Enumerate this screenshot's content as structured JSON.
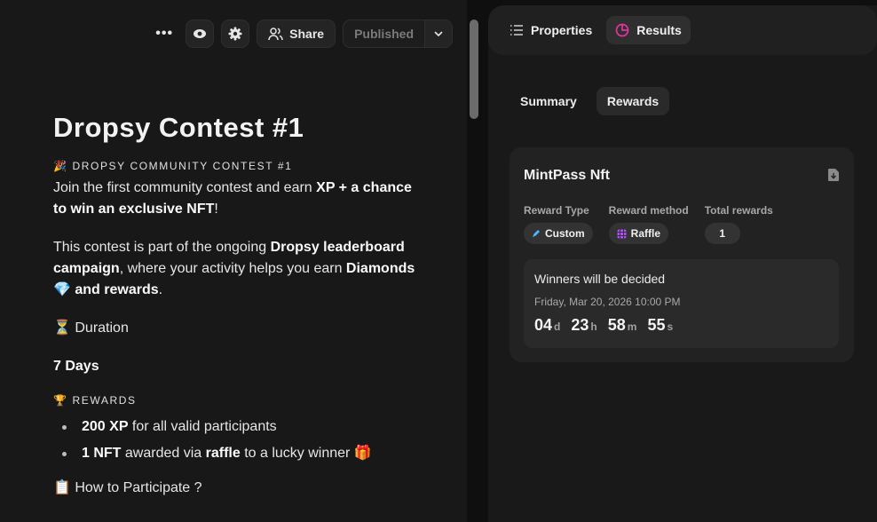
{
  "toolbar": {
    "more_icon": "more-horizontal-icon",
    "preview_icon": "eye-icon",
    "settings_icon": "gear-icon",
    "share_label": "Share",
    "status_label": "Published"
  },
  "article": {
    "title": "Dropsy Contest #1",
    "caption1_emoji": "🎉",
    "caption1": "DROPSY COMMUNITY CONTEST #1",
    "p1_a": "Join the first community contest and earn ",
    "p1_b": "XP + a chance to win an exclusive NFT",
    "p1_c": "!",
    "p2_a": "This contest is part of the ongoing ",
    "p2_b": "Dropsy leaderboard campaign",
    "p2_c": ", where your activity helps you earn ",
    "p2_d": "Diamonds 💎 and rewards",
    "p2_e": ".",
    "duration_label": "⏳ Duration",
    "duration_value": "7 Days",
    "caption2_emoji": "🏆",
    "caption2": "REWARDS",
    "reward1_b": "200 XP",
    "reward1_c": " for all valid participants",
    "reward2_b": "1 NFT",
    "reward2_c": " awarded via ",
    "reward2_d": "raffle",
    "reward2_e": " to a lucky winner 🎁",
    "how_label": "📋 How to Participate ?"
  },
  "panel": {
    "tabs": [
      {
        "label": "Properties",
        "icon": "list-icon"
      },
      {
        "label": "Results",
        "icon": "pie-chart-icon"
      }
    ],
    "subtabs": [
      "Summary",
      "Rewards"
    ],
    "reward": {
      "title": "MintPass Nft",
      "type_label": "Reward Type",
      "type_value": "Custom",
      "method_label": "Reward method",
      "method_value": "Raffle",
      "total_label": "Total rewards",
      "total_value": "1",
      "winners_text": "Winners will be decided",
      "date": "Friday, Mar 20, 2026 10:00 PM",
      "countdown": {
        "days": "04",
        "d": "d",
        "hours": "23",
        "h": "h",
        "minutes": "58",
        "m": "m",
        "seconds": "55",
        "s": "s"
      }
    }
  },
  "colors": {
    "accent_pink": "#e0359c",
    "custom_icon": "#4fb6ff",
    "raffle_icon": "#b14dff"
  }
}
